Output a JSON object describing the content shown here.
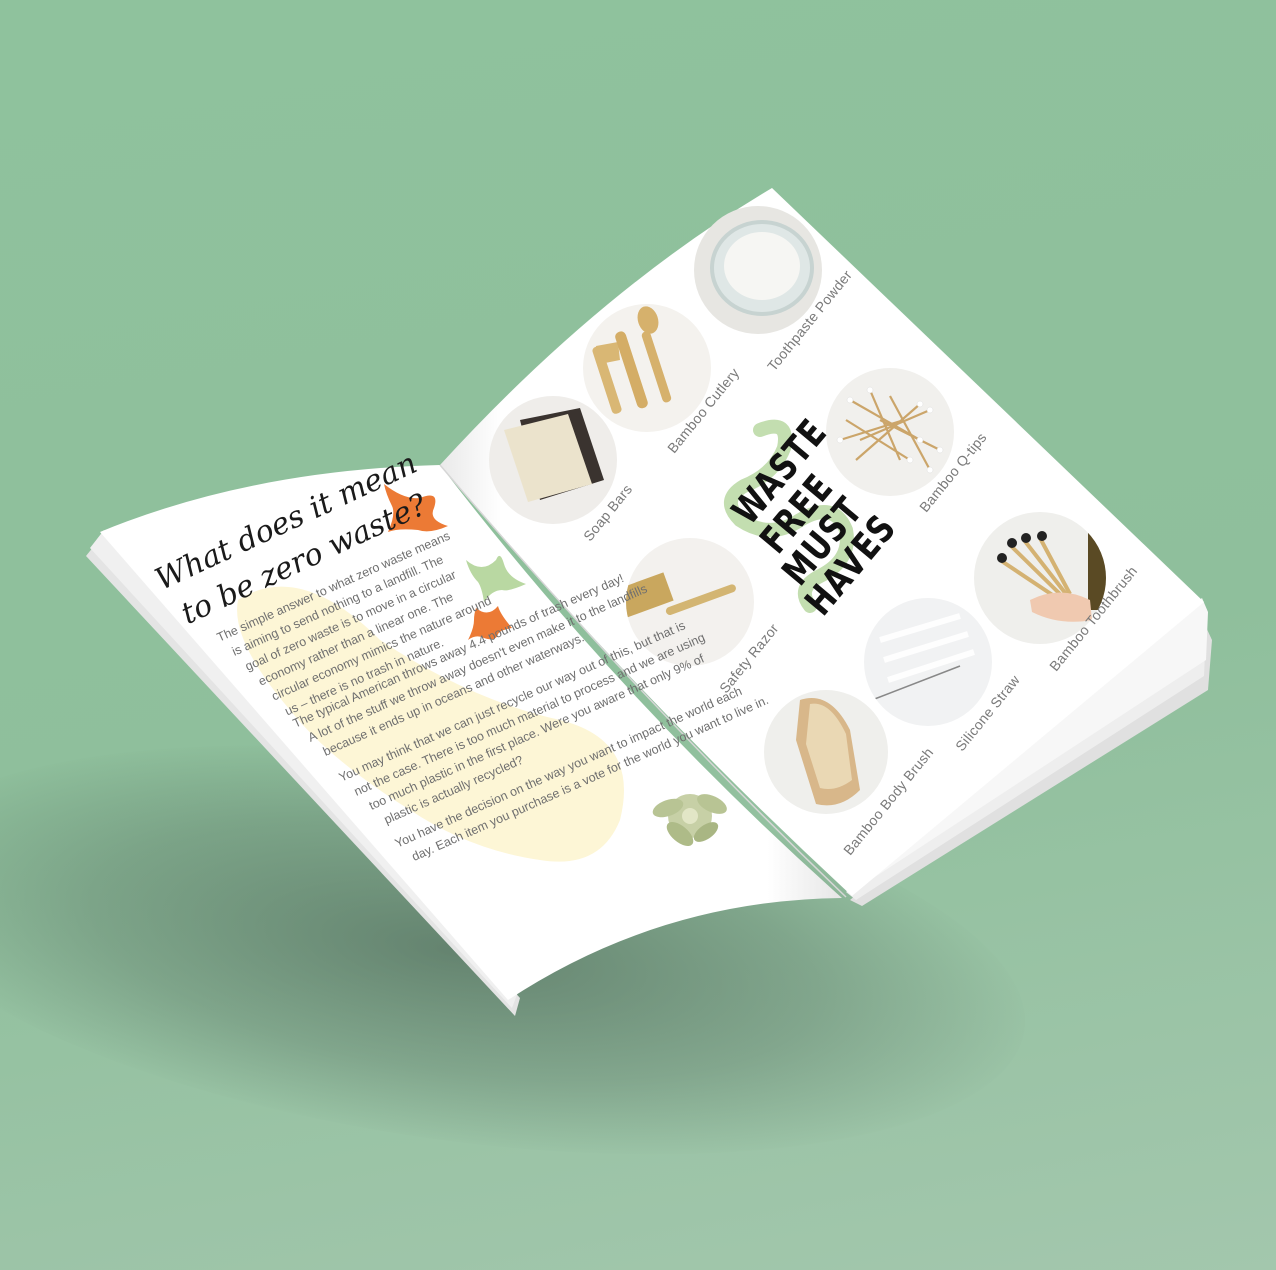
{
  "left_page": {
    "title_line1": "What does it mean",
    "title_line2": "to be zero waste?",
    "paragraphs": [
      [
        "The simple answer to what zero waste means",
        "is aiming to send nothing to a landfill. The",
        "goal of zero waste is to move in a circular",
        "economy rather than a linear one. The",
        "circular economy mimics the nature around",
        "us – there is no trash in nature."
      ],
      [
        "The typical American throws away 4.4 pounds of trash every day!",
        "A lot of the stuff we throw away doesn't even make it to the landfills",
        "because it ends up in oceans and other waterways."
      ],
      [
        "You may think that we can just recycle our way out of this, but that is",
        "not the case. There is too much material to process and we are using",
        "too much plastic in the first place. Were you aware that only 9% of",
        "plastic is actually recycled?"
      ],
      [
        "You have the decision on the way you want to impact the world each",
        "day. Each item you purchase is a vote for the world you want to live in."
      ]
    ]
  },
  "right_page": {
    "heading_lines": [
      "WASTE",
      "FREE",
      "MUST",
      "HAVES"
    ],
    "items": {
      "toothpaste": "Toothpaste Powder",
      "cutlery": "Bamboo Cutlery",
      "soap": "Soap Bars",
      "qtips": "Bamboo Q-tips",
      "razor": "Safety Razor",
      "toothbrush": "Bamboo Toothbrush",
      "straw": "Silicone Straw",
      "bodybrush": "Bamboo Body Brush"
    }
  },
  "colors": {
    "background": "#8fc29d",
    "accent_orange": "#ec7a35",
    "accent_green": "#b9d8a2",
    "blob_yellow": "#fdf6d6"
  }
}
